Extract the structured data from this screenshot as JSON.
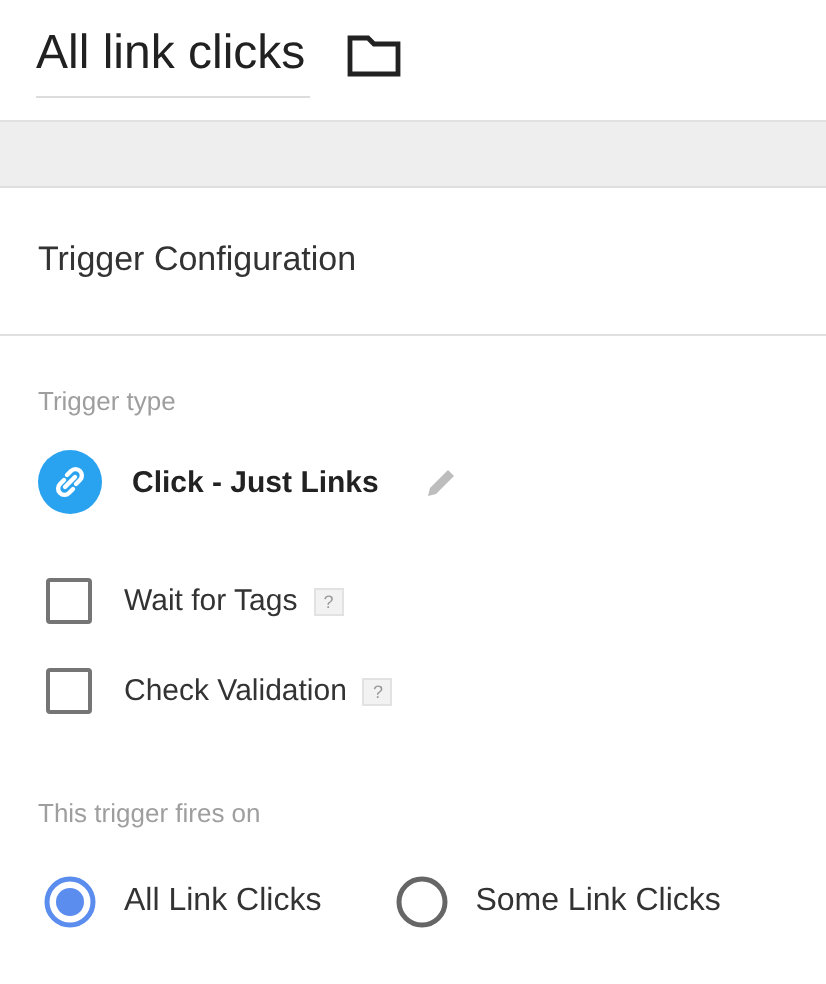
{
  "title": "All link clicks",
  "section": {
    "title": "Trigger Configuration"
  },
  "trigger_type": {
    "label": "Trigger type",
    "name": "Click - Just Links"
  },
  "options": [
    {
      "label": "Wait for Tags",
      "help": "?",
      "checked": false
    },
    {
      "label": "Check Validation",
      "help": "?",
      "checked": false
    }
  ],
  "fires_on": {
    "label": "This trigger fires on",
    "choices": [
      {
        "label": "All Link Clicks",
        "selected": true
      },
      {
        "label": "Some Link Clicks",
        "selected": false
      }
    ]
  }
}
